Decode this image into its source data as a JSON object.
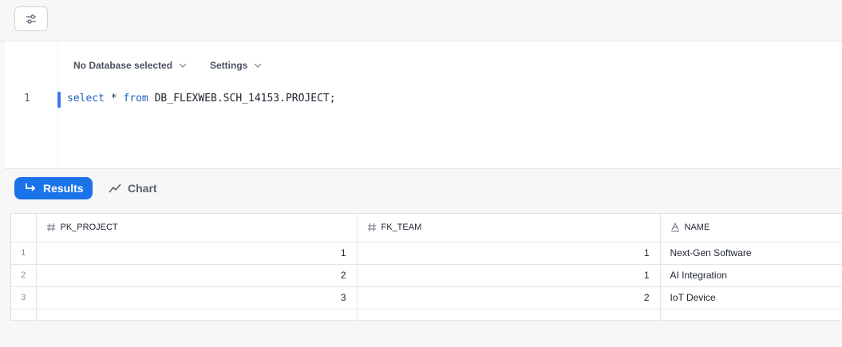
{
  "toolbar": {
    "filter_icon": "sliders-icon"
  },
  "editor": {
    "database_label": "No Database selected",
    "settings_label": "Settings",
    "line_number": "1",
    "code": {
      "kw1": "select",
      "mid1": " * ",
      "kw2": "from",
      "rest": " DB_FLEXWEB.SCH_14153.PROJECT;"
    }
  },
  "results_bar": {
    "results_label": "Results",
    "chart_label": "Chart"
  },
  "table": {
    "columns": [
      {
        "label": "PK_PROJECT",
        "type_icon": "hash-icon"
      },
      {
        "label": "FK_TEAM",
        "type_icon": "hash-icon"
      },
      {
        "label": "NAME",
        "type_icon": "text-type-icon"
      }
    ],
    "rows": [
      {
        "idx": "1",
        "pk": "1",
        "fk": "1",
        "name": "Next-Gen Software"
      },
      {
        "idx": "2",
        "pk": "2",
        "fk": "1",
        "name": "AI Integration"
      },
      {
        "idx": "3",
        "pk": "3",
        "fk": "2",
        "name": "IoT Device"
      }
    ]
  },
  "colors": {
    "accent": "#1a73e8",
    "keyword": "#1f5fbf",
    "line_marker": "#3b78e7"
  }
}
